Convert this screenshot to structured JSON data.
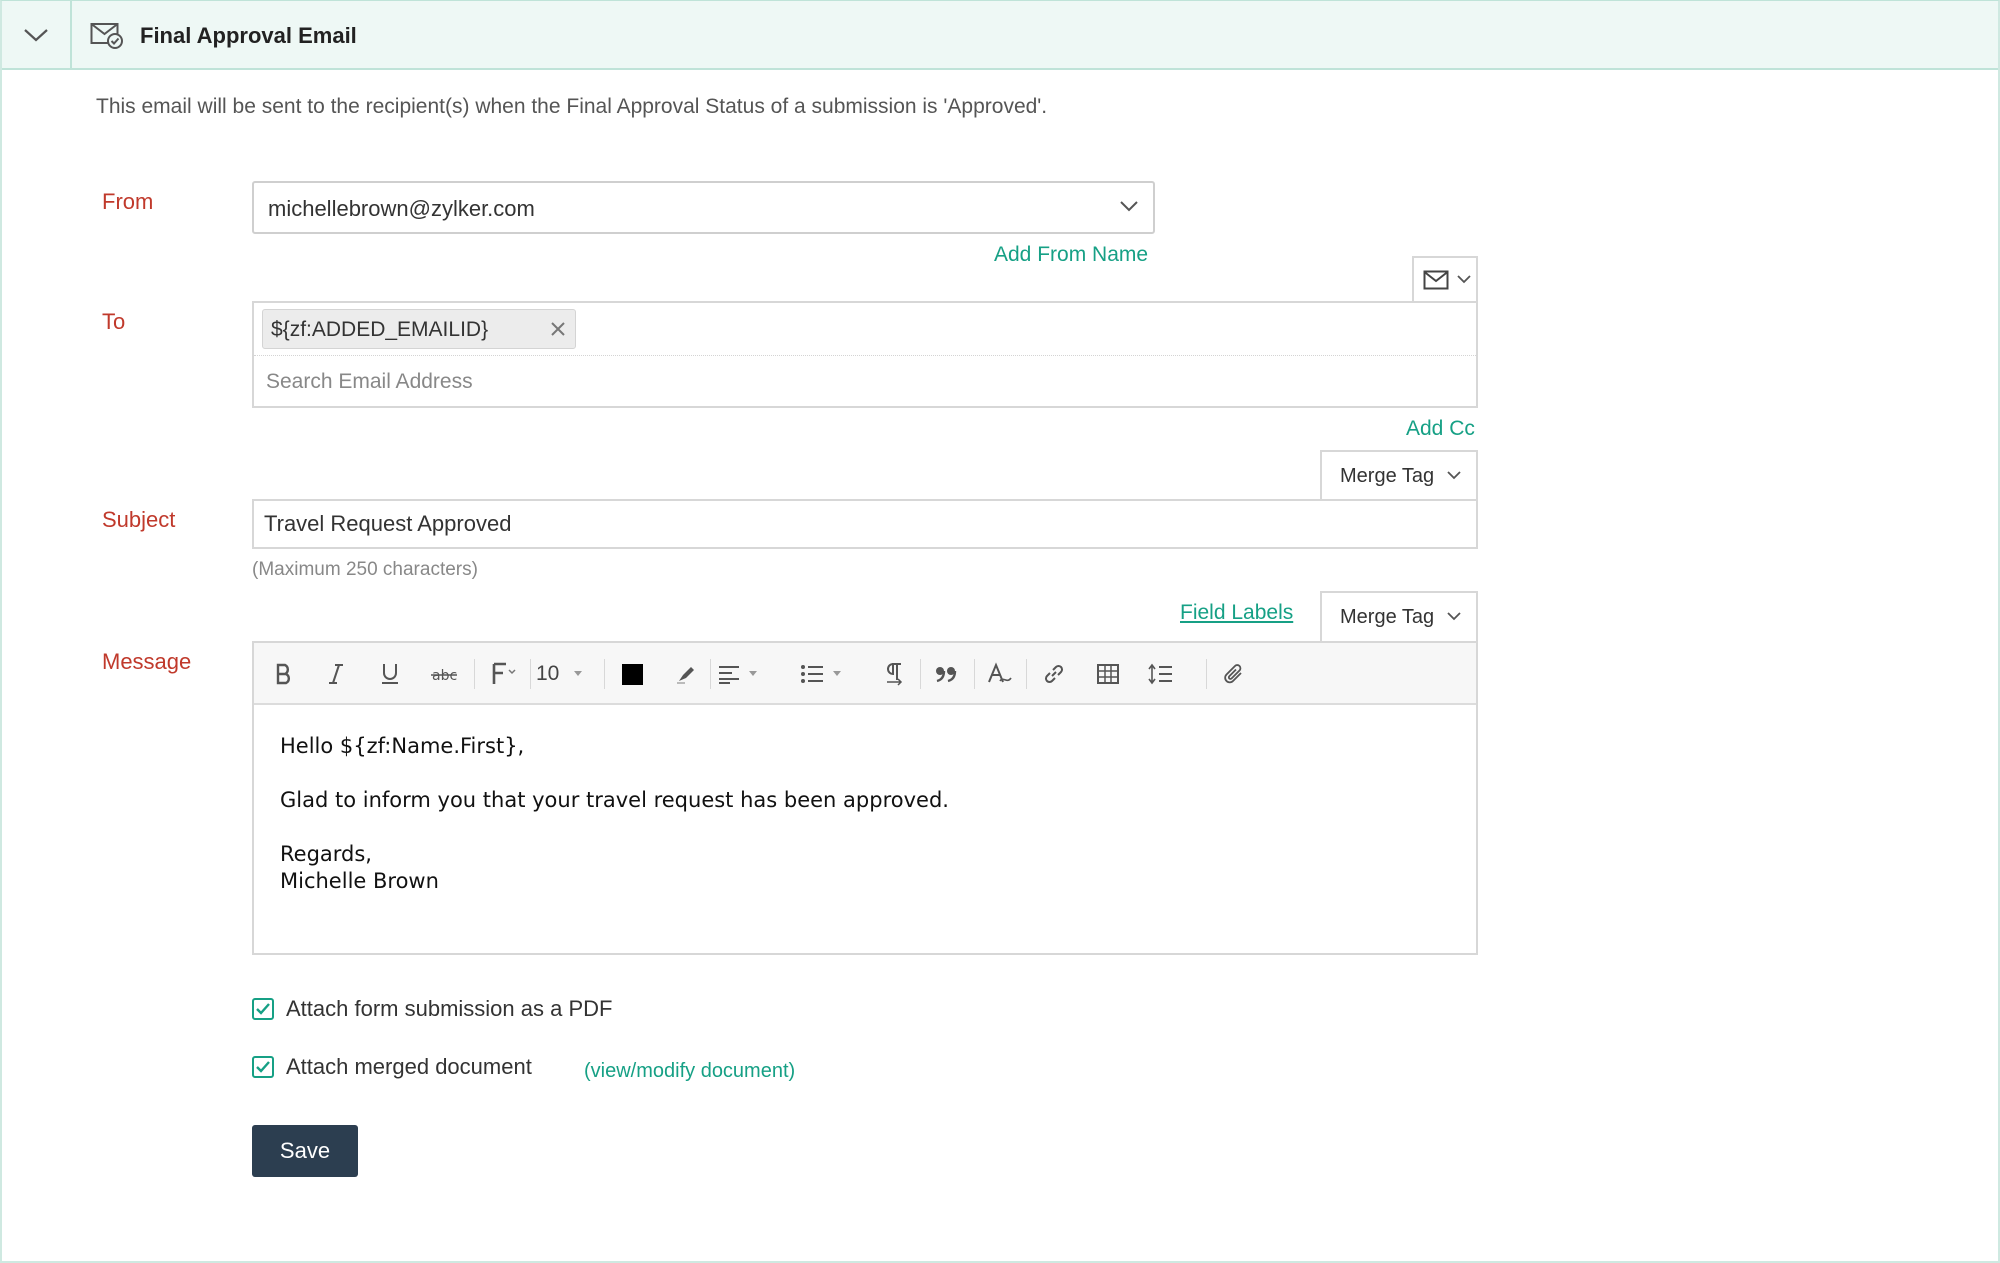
{
  "header": {
    "title": "Final Approval Email",
    "collapse_icon": "chevron-down-icon",
    "title_icon": "mail-check-icon"
  },
  "description": "This email will be sent to the recipient(s) when the Final Approval Status of a submission is 'Approved'.",
  "from": {
    "label": "From",
    "value": "michellebrown@zylker.com",
    "add_from_name": "Add From Name"
  },
  "to": {
    "label": "To",
    "chips": [
      "${zf:ADDED_EMAILID}"
    ],
    "placeholder": "Search Email Address",
    "add_cc": "Add Cc"
  },
  "subject": {
    "label": "Subject",
    "merge_tag": "Merge Tag",
    "value": "Travel Request Approved",
    "hint": "(Maximum 250 characters)"
  },
  "message": {
    "label": "Message",
    "field_labels": "Field Labels",
    "merge_tag": "Merge Tag",
    "font_size": "10",
    "text_color": "#000000",
    "body_lines": [
      "Hello ${zf:Name.First},",
      "",
      "Glad to inform you that your travel request has been approved.",
      "",
      "Regards,",
      "Michelle Brown"
    ]
  },
  "attachments": {
    "pdf_label": "Attach form submission as a PDF",
    "pdf_checked": true,
    "merged_label": "Attach merged document",
    "merged_checked": true,
    "view_modify": "(view/modify document)"
  },
  "save_label": "Save",
  "colors": {
    "accent": "#16a085",
    "label": "#c0392b",
    "header_bg": "#eef8f5",
    "save_bg": "#2c3e50"
  }
}
